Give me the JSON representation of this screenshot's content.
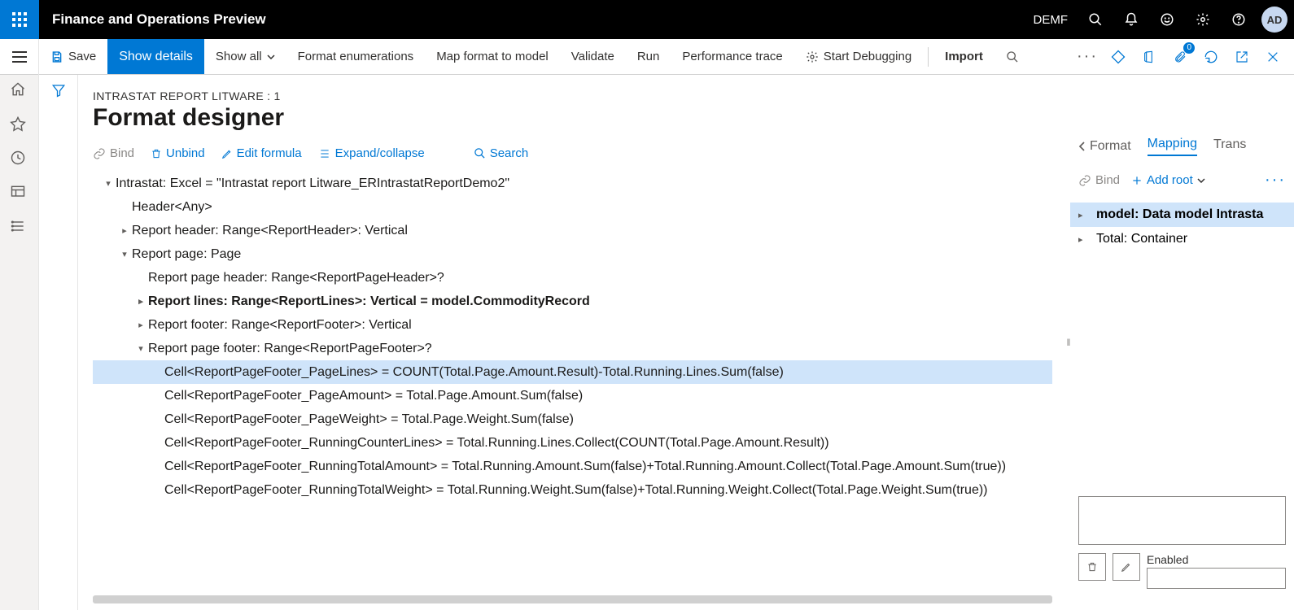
{
  "header": {
    "app_title": "Finance and Operations Preview",
    "tenant": "DEMF",
    "avatar": "AD"
  },
  "action_bar": {
    "save": "Save",
    "show_details": "Show details",
    "show_all": "Show all",
    "format_enumerations": "Format enumerations",
    "map_format_to_model": "Map format to model",
    "validate": "Validate",
    "run": "Run",
    "performance_trace": "Performance trace",
    "start_debugging": "Start Debugging",
    "import": "Import",
    "notification_count": "0"
  },
  "page": {
    "breadcrumb": "INTRASTAT REPORT LITWARE : 1",
    "title": "Format designer"
  },
  "sub_toolbar": {
    "bind": "Bind",
    "unbind": "Unbind",
    "edit_formula": "Edit formula",
    "expand_collapse": "Expand/collapse",
    "search": "Search"
  },
  "tree": [
    {
      "indent": 0,
      "twist": "down",
      "bold": false,
      "selected": false,
      "text": "Intrastat: Excel = \"Intrastat report Litware_ERIntrastatReportDemo2\""
    },
    {
      "indent": 1,
      "twist": "",
      "bold": false,
      "selected": false,
      "text": "Header<Any>"
    },
    {
      "indent": 1,
      "twist": "right",
      "bold": false,
      "selected": false,
      "text": "Report header: Range<ReportHeader>: Vertical"
    },
    {
      "indent": 1,
      "twist": "down",
      "bold": false,
      "selected": false,
      "text": "Report page: Page"
    },
    {
      "indent": 2,
      "twist": "",
      "bold": false,
      "selected": false,
      "text": "Report page header: Range<ReportPageHeader>?"
    },
    {
      "indent": 2,
      "twist": "right",
      "bold": true,
      "selected": false,
      "text": "Report lines: Range<ReportLines>: Vertical = model.CommodityRecord"
    },
    {
      "indent": 2,
      "twist": "right",
      "bold": false,
      "selected": false,
      "text": "Report footer: Range<ReportFooter>: Vertical"
    },
    {
      "indent": 2,
      "twist": "down",
      "bold": false,
      "selected": false,
      "text": "Report page footer: Range<ReportPageFooter>?"
    },
    {
      "indent": 3,
      "twist": "",
      "bold": false,
      "selected": true,
      "text": "Cell<ReportPageFooter_PageLines> = COUNT(Total.Page.Amount.Result)-Total.Running.Lines.Sum(false)"
    },
    {
      "indent": 3,
      "twist": "",
      "bold": false,
      "selected": false,
      "text": "Cell<ReportPageFooter_PageAmount> = Total.Page.Amount.Sum(false)"
    },
    {
      "indent": 3,
      "twist": "",
      "bold": false,
      "selected": false,
      "text": "Cell<ReportPageFooter_PageWeight> = Total.Page.Weight.Sum(false)"
    },
    {
      "indent": 3,
      "twist": "",
      "bold": false,
      "selected": false,
      "text": "Cell<ReportPageFooter_RunningCounterLines> = Total.Running.Lines.Collect(COUNT(Total.Page.Amount.Result))"
    },
    {
      "indent": 3,
      "twist": "",
      "bold": false,
      "selected": false,
      "text": "Cell<ReportPageFooter_RunningTotalAmount> = Total.Running.Amount.Sum(false)+Total.Running.Amount.Collect(Total.Page.Amount.Sum(true))"
    },
    {
      "indent": 3,
      "twist": "",
      "bold": false,
      "selected": false,
      "text": "Cell<ReportPageFooter_RunningTotalWeight> = Total.Running.Weight.Sum(false)+Total.Running.Weight.Collect(Total.Page.Weight.Sum(true))"
    }
  ],
  "right": {
    "back": "Format",
    "tab_mapping": "Mapping",
    "tab_trans": "Trans",
    "bind": "Bind",
    "add_root": "Add root",
    "tree": [
      {
        "selected": true,
        "text": "model: Data model Intrasta"
      },
      {
        "selected": false,
        "text": "Total: Container"
      }
    ],
    "enabled_label": "Enabled"
  }
}
